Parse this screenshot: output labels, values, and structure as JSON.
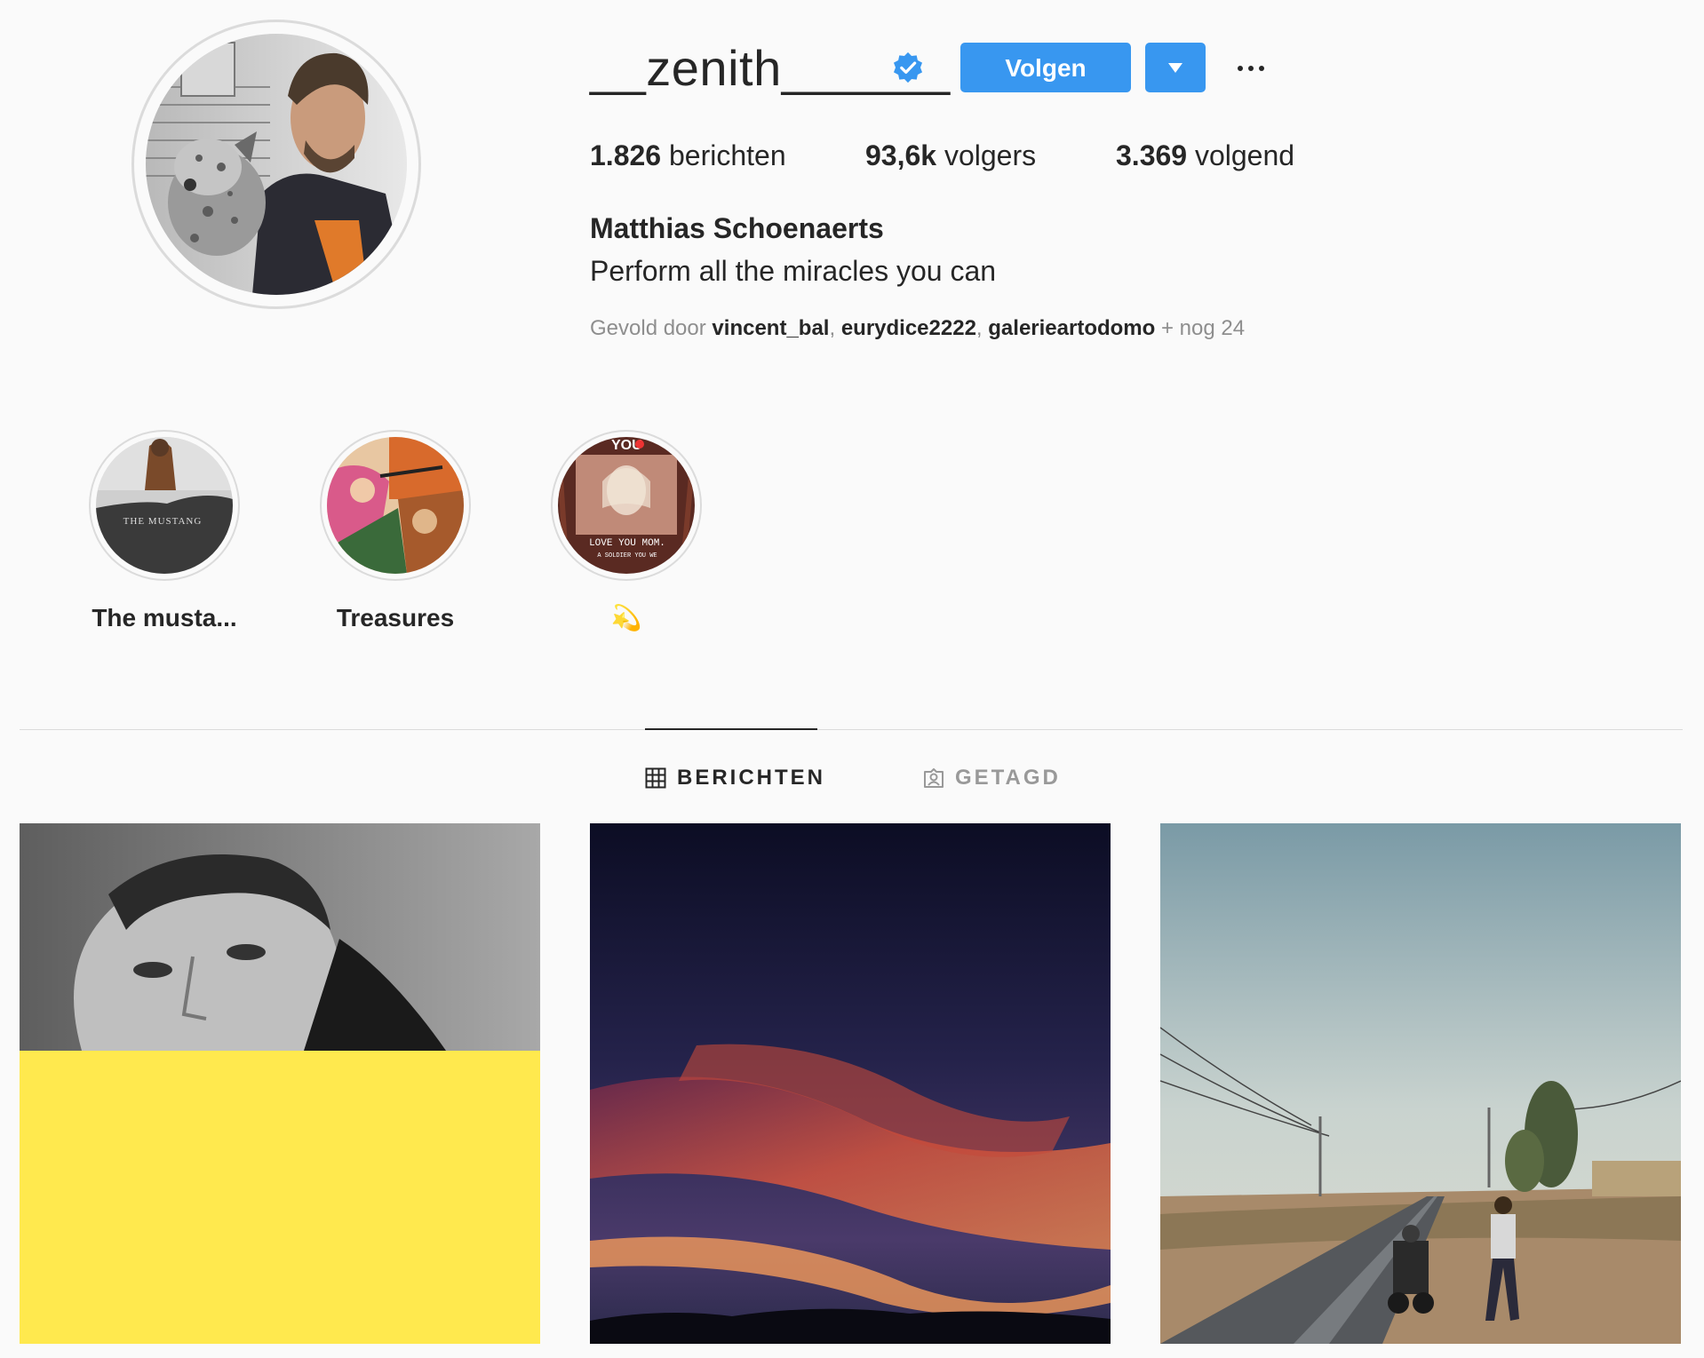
{
  "profile": {
    "username": "__zenith______",
    "verified": true,
    "follow_label": "Volgen",
    "stats": {
      "posts_count": "1.826",
      "posts_label": "berichten",
      "followers_count": "93,6k",
      "followers_label": "volgers",
      "following_count": "3.369",
      "following_label": "volgend"
    },
    "full_name": "Matthias Schoenaerts",
    "bio": "Perform all the miracles you can",
    "followed_by": {
      "prefix": "Gevold door",
      "users": [
        "vincent_bal",
        "eurydice2222",
        "galerieartodomo"
      ],
      "suffix": "+ nog 24"
    }
  },
  "highlights": [
    {
      "label": "The musta...",
      "image_text": "THE MUSTANG"
    },
    {
      "label": "Treasures"
    },
    {
      "label": "💫",
      "image_text_top": "YOU",
      "image_text_bottom": "LOVE YOU MOM.",
      "image_text_small": "A SOLDIER YOU WE"
    }
  ],
  "tabs": [
    {
      "label": "BERICHTEN",
      "icon": "grid-icon",
      "active": true
    },
    {
      "label": "GETAGD",
      "icon": "tagged-icon",
      "active": false
    }
  ],
  "colors": {
    "accent": "#3897f0",
    "background": "#fafafa",
    "text": "#262626",
    "muted": "#8e8e8e",
    "border": "#dbdbdb",
    "post_yellow": "#ffe94e"
  },
  "posts": [
    {
      "description_icon": "portrait-photo"
    },
    {
      "description_icon": "sunset-photo"
    },
    {
      "description_icon": "road-photo"
    }
  ]
}
